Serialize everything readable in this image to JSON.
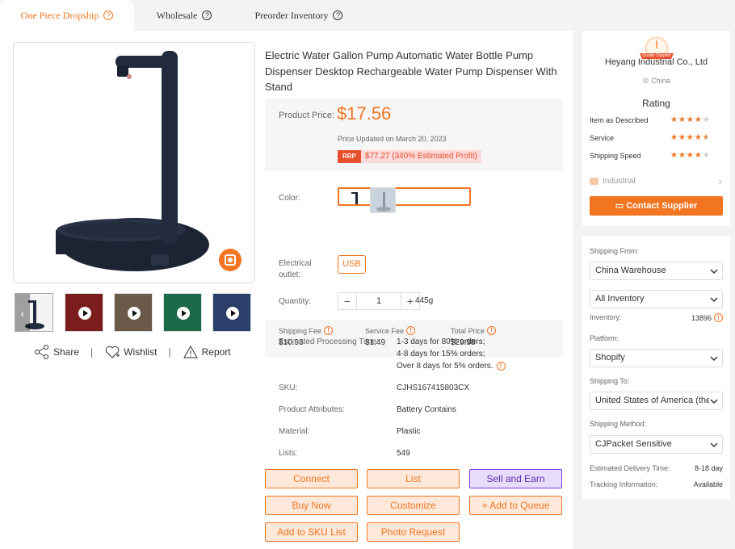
{
  "tabs": [
    {
      "label": "One Piece Dropship"
    },
    {
      "label": "Wholesale"
    },
    {
      "label": "Preorder Inventory"
    }
  ],
  "product": {
    "title": "Electric Water Gallon Pump Automatic Water Bottle Pump Dispenser Desktop Rechargeable Water Pump Dispenser With Stand",
    "price_label": "Product Price:",
    "price": "$17.56",
    "price_updated": "Price Updated on March 20, 2023",
    "rrp_tag": "RRP",
    "rrp_value": "$77.27 (340% Estimated Profit)"
  },
  "gallery": {
    "actions": {
      "share": "Share",
      "wishlist": "Wishlist",
      "report": "Report",
      "separator": "|"
    }
  },
  "options": {
    "color_label": "Color:",
    "outlet_label": "Electrical outlet:",
    "outlet_value": "USB",
    "quantity_label": "Quantity:",
    "quantity": "1",
    "minus": "−",
    "plus": "+",
    "weight": "445g"
  },
  "fees": {
    "shipping_label": "Shipping Fee",
    "shipping_value": "$10.93",
    "service_label": "Service Fee",
    "service_value": "$1.49",
    "total_label": "Total Price",
    "total_value": "$29.98"
  },
  "details": {
    "processing_label": "Estimated Processing Time:",
    "processing_lines": [
      "1-3 days for 80% orders;",
      "4-8 days for 15% orders;",
      "Over 8 days for 5% orders."
    ],
    "sku_label": "SKU:",
    "sku": "CJHS167415803CX",
    "attributes_label": "Product Attributes:",
    "attributes": "Battery Contains",
    "material_label": "Material:",
    "material": "Plastic",
    "lists_label": "Lists:",
    "lists": "549"
  },
  "buttons": {
    "connect": "Connect",
    "list": "List",
    "sell_and_earn": "Sell and Earn",
    "buy_now": "Buy Now",
    "customize": "Customize",
    "add_to_queue": "+ Add to Queue",
    "add_to_sku_list": "Add to SKU List",
    "photo_request": "Photo Request"
  },
  "supplier": {
    "badge_letter": "I",
    "badge_ribbon": "Quality Supplier",
    "name": "Heyang Industrial Co., Ltd",
    "country": "China",
    "rating_title": "Rating",
    "ratings": [
      {
        "label": "Item as Described",
        "stars": 4
      },
      {
        "label": "Service",
        "stars": 4.5
      },
      {
        "label": "Shipping Speed",
        "stars": 4
      }
    ],
    "category": "Industrial",
    "contact_button": "Contact Supplier"
  },
  "shipping": {
    "from_label": "Shipping From:",
    "from_value": "China Warehouse",
    "inventory_value": "All Inventory",
    "inventory_label": "Inventory:",
    "inventory_count": "13896",
    "platform_label": "Platform:",
    "platform_value": "Shopify",
    "to_label": "Shipping To:",
    "to_value": "United States of America (the)",
    "method_label": "Shipping Method:",
    "method_value": "CJPacket Sensitive",
    "delivery_label": "Estimated Delivery Time:",
    "delivery_value": "8-18 day",
    "tracking_label": "Tracking Information:",
    "tracking_value": "Available"
  },
  "colors": {
    "accent": "#f27521",
    "purple": "#7b3fe4"
  }
}
